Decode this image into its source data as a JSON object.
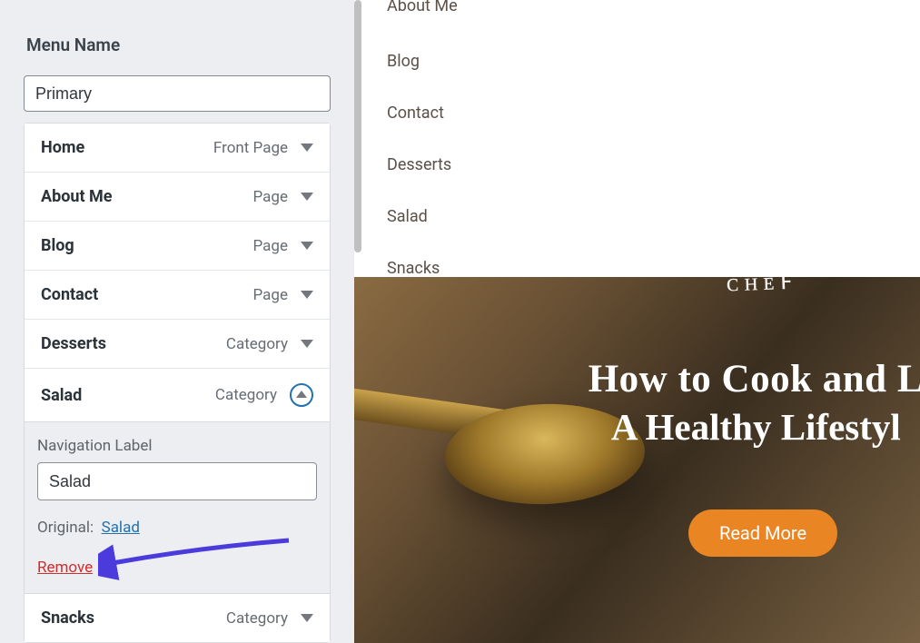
{
  "sidebar": {
    "section_title": "Menu Name",
    "menu_name_value": "Primary",
    "items": [
      {
        "label": "Home",
        "type": "Front Page",
        "expanded": false
      },
      {
        "label": "About Me",
        "type": "Page",
        "expanded": false
      },
      {
        "label": "Blog",
        "type": "Page",
        "expanded": false
      },
      {
        "label": "Contact",
        "type": "Page",
        "expanded": false
      },
      {
        "label": "Desserts",
        "type": "Category",
        "expanded": false
      },
      {
        "label": "Salad",
        "type": "Category",
        "expanded": true
      },
      {
        "label": "Snacks",
        "type": "Category",
        "expanded": false
      }
    ],
    "expanded_panel": {
      "field_label": "Navigation Label",
      "nav_label_value": "Salad",
      "original_label": "Original:",
      "original_link": "Salad",
      "remove_label": "Remove"
    }
  },
  "preview": {
    "nav_items": [
      "About Me",
      "Blog",
      "Contact",
      "Desserts",
      "Salad",
      "Snacks"
    ],
    "hero": {
      "line1": "How to Cook and L",
      "line2": "A Healthy Lifestyl",
      "button": "Read More"
    }
  }
}
